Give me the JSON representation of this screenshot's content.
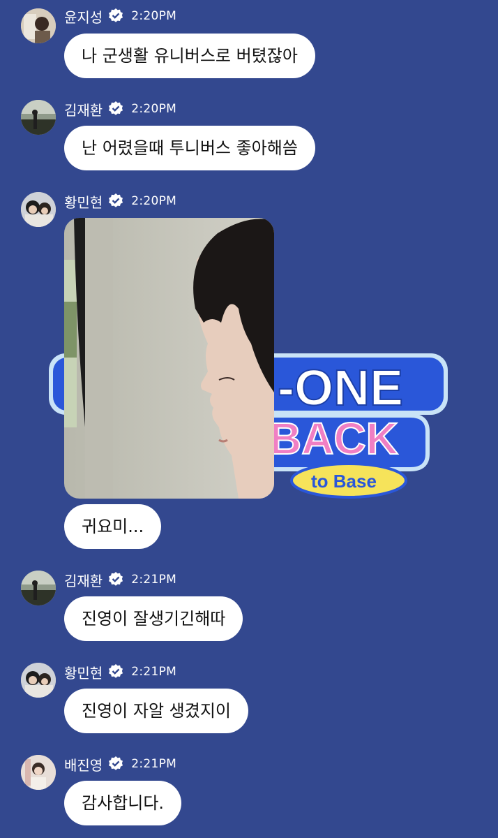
{
  "watermark": {
    "line1": "-ONE",
    "line2": "BACK",
    "tag": "to Base",
    "colors": {
      "outline": "#a9d4f3",
      "blue": "#2a57d9",
      "pink": "#f07fc4",
      "yellow": "#f6e35a"
    }
  },
  "messages": [
    {
      "sender": "윤지성",
      "time": "2:20PM",
      "text": "나 군생활 유니버스로 버텼잖아"
    },
    {
      "sender": "김재환",
      "time": "2:20PM",
      "text": "난 어렸을때 투니버스 좋아해씀"
    },
    {
      "sender": "황민현",
      "time": "2:20PM",
      "text": "귀요미..."
    },
    {
      "sender": "김재환",
      "time": "2:21PM",
      "text": "진영이 잘생기긴해따"
    },
    {
      "sender": "황민현",
      "time": "2:21PM",
      "text": "진영이 자알 생겼지이"
    },
    {
      "sender": "배진영",
      "time": "2:21PM",
      "text": "감사합니다."
    }
  ],
  "colors": {
    "background": "#33488f",
    "bubble": "#ffffff",
    "verified_badge": "#ffffff"
  }
}
